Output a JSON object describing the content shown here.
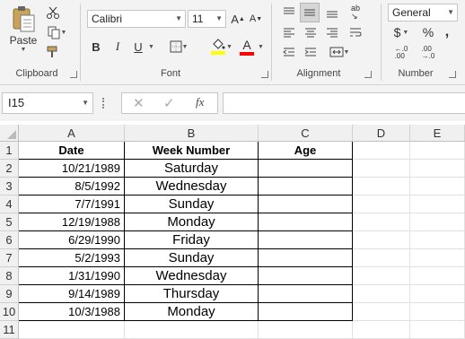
{
  "ribbon": {
    "clipboard": {
      "paste_label": "Paste",
      "group_label": "Clipboard"
    },
    "font": {
      "name": "Calibri",
      "size": "11",
      "group_label": "Font",
      "bold": "B",
      "italic": "I",
      "underline": "U"
    },
    "alignment": {
      "group_label": "Alignment"
    },
    "number": {
      "format": "General",
      "group_label": "Number",
      "currency": "$",
      "percent": "%",
      "comma": ","
    }
  },
  "formula_bar": {
    "name_box": "I15",
    "formula": ""
  },
  "columns": [
    "A",
    "B",
    "C",
    "D",
    "E"
  ],
  "rows": [
    "1",
    "2",
    "3",
    "4",
    "5",
    "6",
    "7",
    "8",
    "9",
    "10",
    "11"
  ],
  "table": {
    "headers": {
      "date": "Date",
      "week": "Week Number",
      "age": "Age"
    },
    "data": [
      {
        "date": "10/21/1989",
        "day": "Saturday"
      },
      {
        "date": "8/5/1992",
        "day": "Wednesday"
      },
      {
        "date": "7/7/1991",
        "day": "Sunday"
      },
      {
        "date": "12/19/1988",
        "day": "Monday"
      },
      {
        "date": "6/29/1990",
        "day": "Friday"
      },
      {
        "date": "5/2/1993",
        "day": "Sunday"
      },
      {
        "date": "1/31/1990",
        "day": "Wednesday"
      },
      {
        "date": "9/14/1989",
        "day": "Thursday"
      },
      {
        "date": "10/3/1988",
        "day": "Monday"
      }
    ]
  },
  "colors": {
    "highlight": "#ffff00",
    "font_color": "#ff0000",
    "ribbon_bg": "#f3f3f3"
  }
}
